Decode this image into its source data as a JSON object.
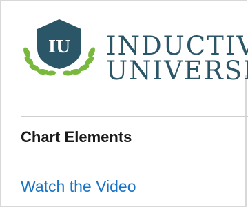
{
  "logo": {
    "line1": "INDUCTIV",
    "line2": "UNIVERSI",
    "badge": "IU",
    "icon": "laurel-shield-icon",
    "colors": {
      "shield": "#2b5667",
      "laurel": "#78b83c",
      "text": "#2b5667"
    }
  },
  "section": {
    "title": "Chart Elements"
  },
  "link": {
    "label": "Watch the Video",
    "color": "#1874c7"
  }
}
